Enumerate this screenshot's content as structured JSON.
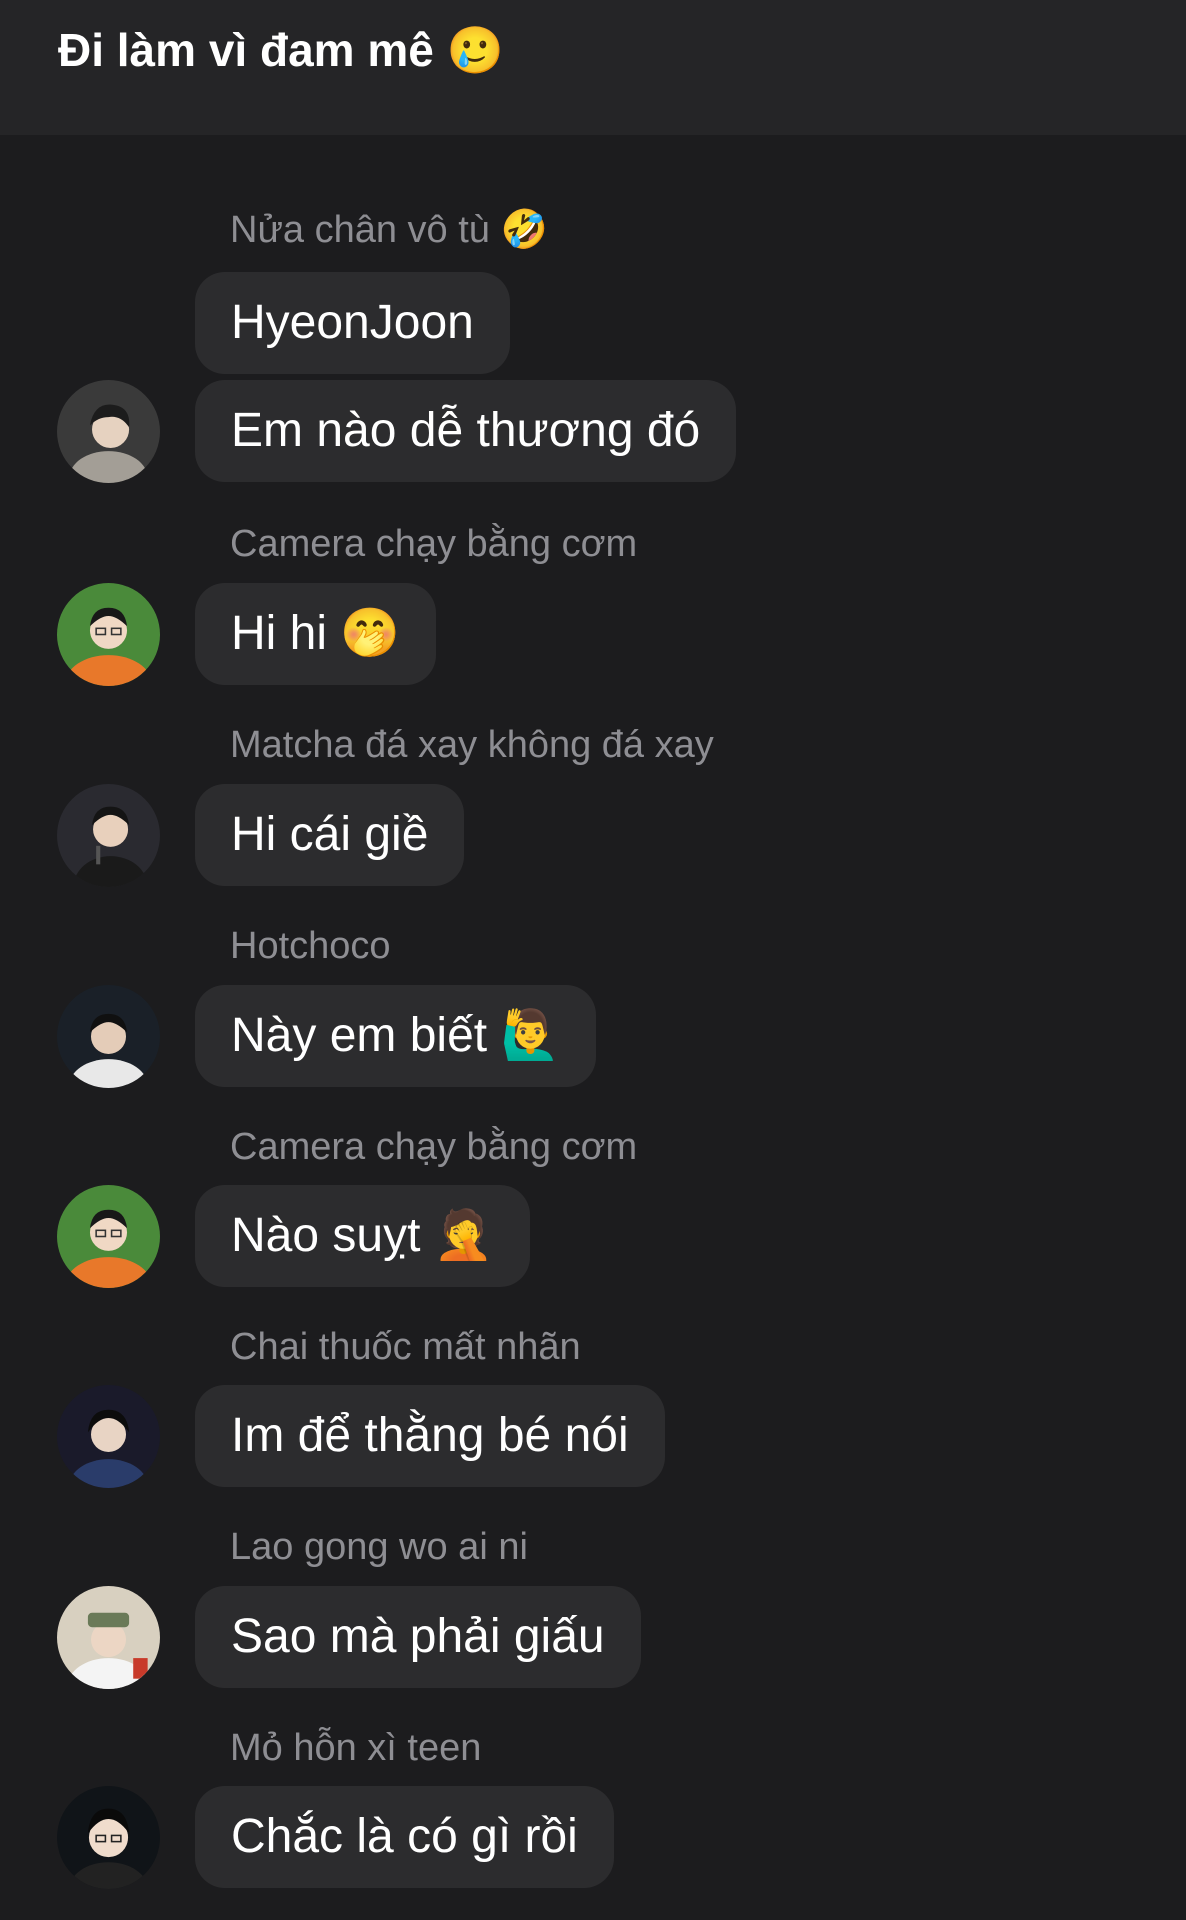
{
  "header": {
    "title": "Đi làm vì đam mê 🥲"
  },
  "messages": [
    {
      "sender": "Nửa chân vô tù 🤣",
      "text": "HyeonJoon"
    },
    {
      "sender": "",
      "text": "Em nào dễ thương đó"
    },
    {
      "sender": "Camera chạy bằng cơm",
      "text": "Hi hi 🤭"
    },
    {
      "sender": "Matcha đá xay không đá xay",
      "text": "Hi cái giề"
    },
    {
      "sender": "Hotchoco",
      "text": "Này em biết 🙋‍♂️"
    },
    {
      "sender": "Camera chạy bằng cơm",
      "text": "Nào suỵt 🤦"
    },
    {
      "sender": "Chai thuốc mất nhãn",
      "text": "Im để thằng bé nói"
    },
    {
      "sender": "Lao gong wo ai ni",
      "text": "Sao mà phải giấu"
    },
    {
      "sender": "Mỏ hỗn xì teen",
      "text": "Chắc là có gì rồi"
    }
  ],
  "avatar_colors": {
    "avatar_1": "#3a3a3a",
    "avatar_2": "#4a8a3a",
    "avatar_3": "#2a2a30",
    "avatar_4": "#1a2028",
    "avatar_5": "#4a8a3a",
    "avatar_6": "#1a1a2a",
    "avatar_7": "#d8d0c0",
    "avatar_8": "#101418"
  }
}
